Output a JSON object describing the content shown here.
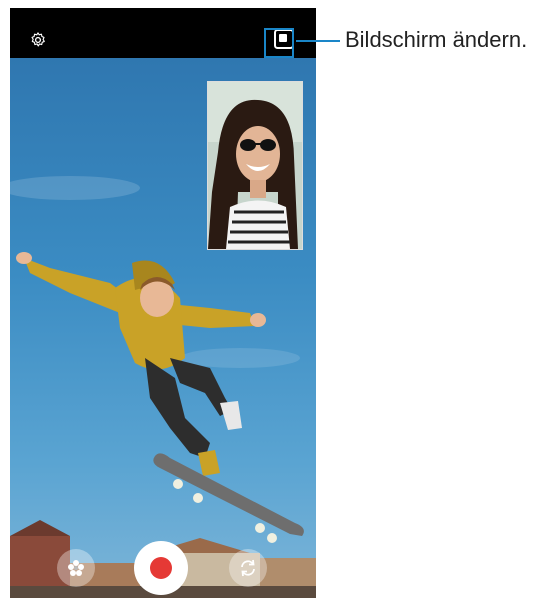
{
  "callout": {
    "text": "Bildschirm ändern."
  },
  "icons": {
    "settings": "gear-icon",
    "switch_screen": "switch-screen-icon",
    "effects": "flower-icon",
    "record": "record-icon",
    "flip": "flip-camera-icon"
  },
  "colors": {
    "record_dot": "#e53935",
    "callout_accent": "#1a86c8",
    "top_bar": "#000000"
  }
}
